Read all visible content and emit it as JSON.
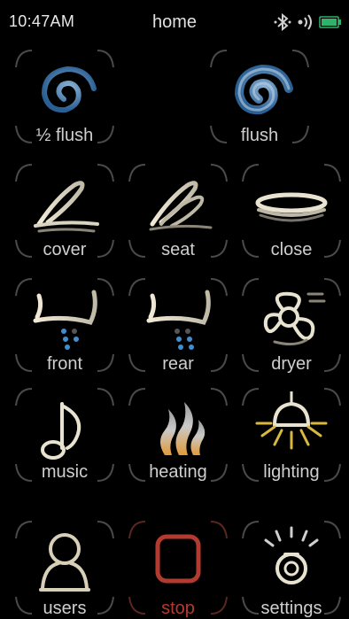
{
  "status_bar": {
    "time": "10:47AM",
    "title": "home",
    "icons": [
      "bluetooth-connected-icon",
      "wireless-signal-icon",
      "battery-icon"
    ],
    "battery_color": "#2fb36a"
  },
  "buttons": {
    "half_flush": "½ flush",
    "flush": "flush",
    "cover": "cover",
    "seat": "seat",
    "close": "close",
    "front": "front",
    "rear": "rear",
    "dryer": "dryer",
    "music": "music",
    "heating": "heating",
    "lighting": "lighting",
    "users": "users",
    "stop": "stop",
    "settings": "settings"
  },
  "colors": {
    "background": "#000000",
    "label": "#cfcfcf",
    "frame": "#4a4a4a",
    "flush_accent": "#4a86b8",
    "stop_accent": "#b33a2e",
    "spray_dots": "#3f8fd0",
    "flame": "#e09a3a",
    "light_rays": "#d9b840"
  }
}
